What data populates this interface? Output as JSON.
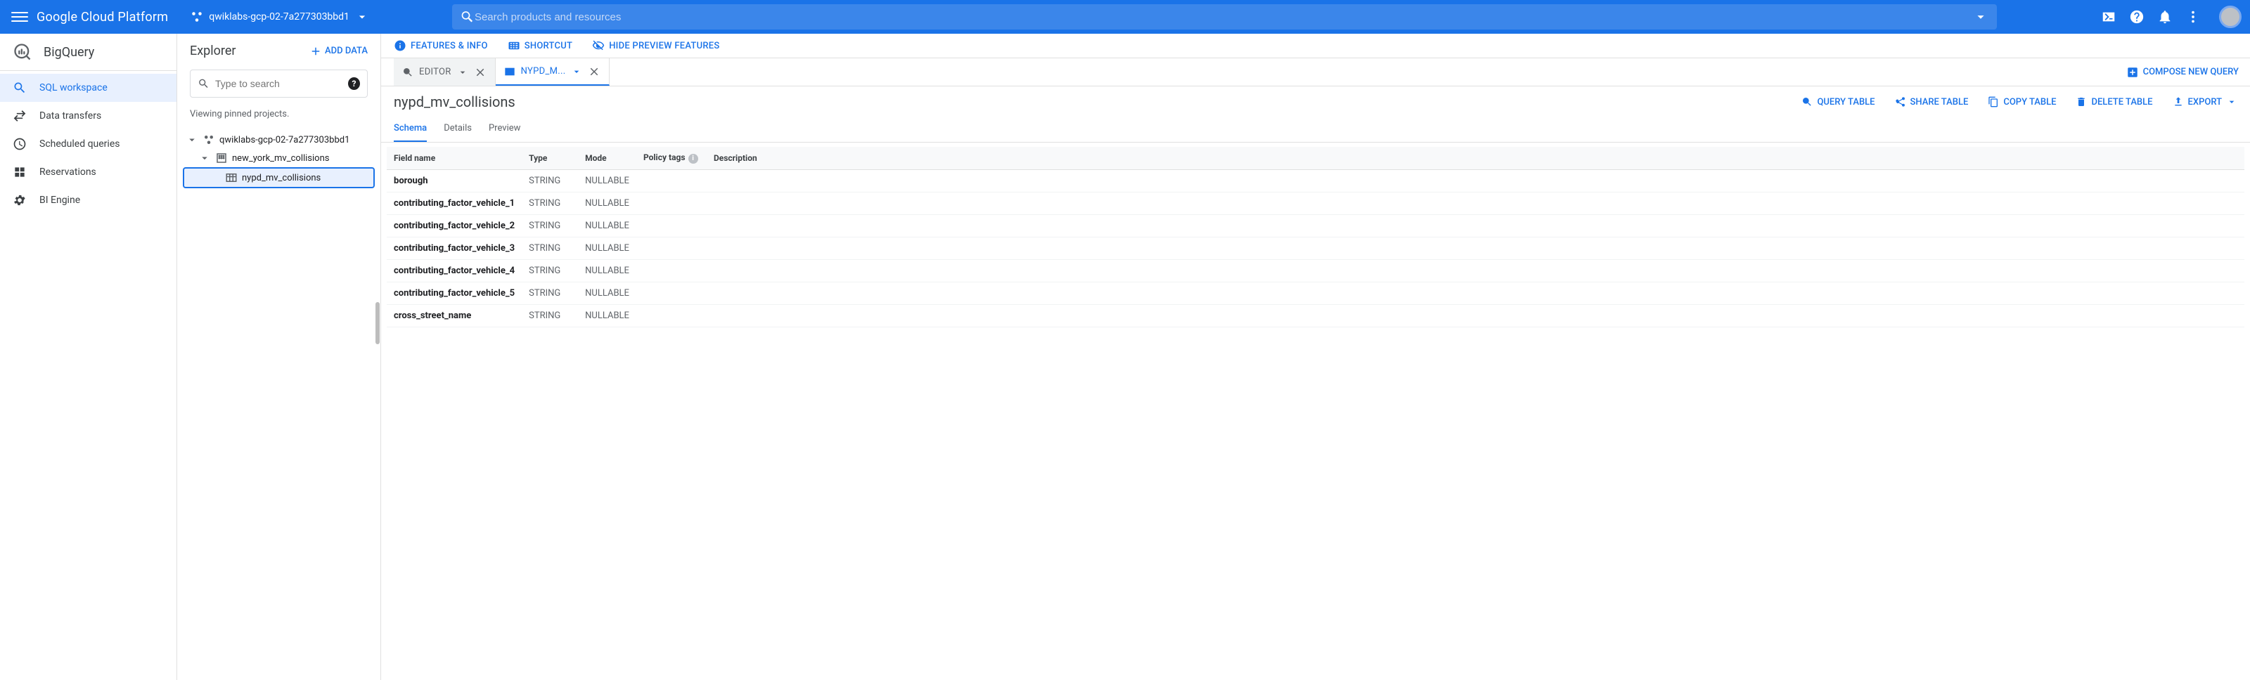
{
  "header": {
    "title": "Google Cloud Platform",
    "project": "qwiklabs-gcp-02-7a277303bbd1",
    "search_placeholder": "Search products and resources"
  },
  "sidebar": {
    "product": "BigQuery",
    "items": [
      {
        "label": "SQL workspace"
      },
      {
        "label": "Data transfers"
      },
      {
        "label": "Scheduled queries"
      },
      {
        "label": "Reservations"
      },
      {
        "label": "BI Engine"
      }
    ]
  },
  "explorer": {
    "title": "Explorer",
    "add_label": "ADD DATA",
    "search_placeholder": "Type to search",
    "pin_note": "Viewing pinned projects.",
    "tree": {
      "project": "qwiklabs-gcp-02-7a277303bbd1",
      "dataset": "new_york_mv_collisions",
      "table": "nypd_mv_collisions"
    }
  },
  "toolbar": {
    "features": "FEATURES & INFO",
    "shortcut": "SHORTCUT",
    "hide_preview": "HIDE PREVIEW FEATURES"
  },
  "tabs": {
    "editor": "EDITOR",
    "table_short": "NYPD_M...",
    "compose": "COMPOSE NEW QUERY"
  },
  "table": {
    "name": "nypd_mv_collisions",
    "actions": {
      "query": "QUERY TABLE",
      "share": "SHARE TABLE",
      "copy": "COPY TABLE",
      "delete": "DELETE TABLE",
      "export": "EXPORT"
    },
    "subtabs": {
      "schema": "Schema",
      "details": "Details",
      "preview": "Preview"
    },
    "columns": {
      "field": "Field name",
      "type": "Type",
      "mode": "Mode",
      "policy": "Policy tags",
      "desc": "Description"
    },
    "fields": [
      {
        "name": "borough",
        "type": "STRING",
        "mode": "NULLABLE"
      },
      {
        "name": "contributing_factor_vehicle_1",
        "type": "STRING",
        "mode": "NULLABLE"
      },
      {
        "name": "contributing_factor_vehicle_2",
        "type": "STRING",
        "mode": "NULLABLE"
      },
      {
        "name": "contributing_factor_vehicle_3",
        "type": "STRING",
        "mode": "NULLABLE"
      },
      {
        "name": "contributing_factor_vehicle_4",
        "type": "STRING",
        "mode": "NULLABLE"
      },
      {
        "name": "contributing_factor_vehicle_5",
        "type": "STRING",
        "mode": "NULLABLE"
      },
      {
        "name": "cross_street_name",
        "type": "STRING",
        "mode": "NULLABLE"
      }
    ]
  }
}
